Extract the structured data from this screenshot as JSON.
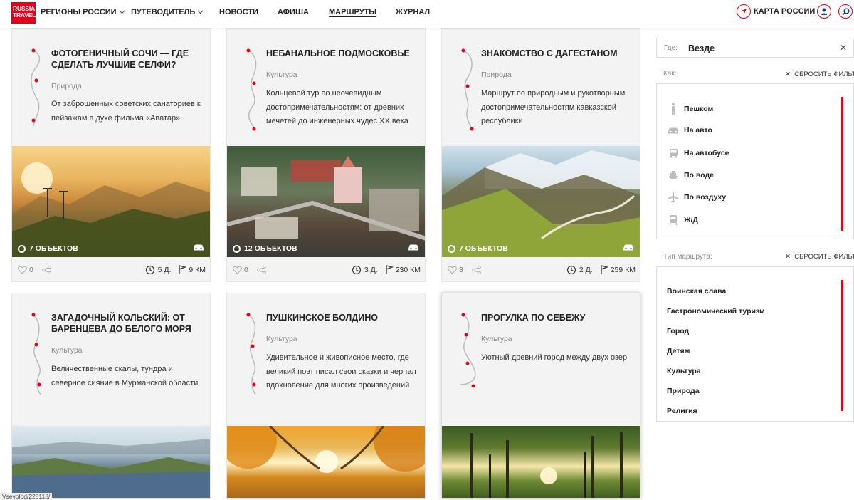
{
  "header": {
    "logo": {
      "line1": "RUSSIA",
      "line2": "TRAVEL"
    },
    "nav": [
      "РЕГИОНЫ РОССИИ",
      "ПУТЕВОДИТЕЛЬ",
      "НОВОСТИ",
      "АФИША",
      "МАРШРУТЫ",
      "ЖУРНАЛ"
    ],
    "map_label": "КАРТА РОССИИ"
  },
  "cards": [
    {
      "title": "ФОТОГЕНИЧНЫЙ СОЧИ — ГДЕ СДЕЛАТЬ ЛУЧШИЕ СЕЛФИ?",
      "category": "Природа",
      "desc": "От заброшенных советских санаториев к пейзажам в духе фильма «Аватар»",
      "objects": "7 ОБЪЕКТОВ",
      "likes": "0",
      "duration": "5 Д.",
      "distance": "9 КМ"
    },
    {
      "title": "НЕБАНАЛЬНОЕ ПОДМОСКОВЬЕ",
      "category": "Культура",
      "desc": "Кольцевой тур по неочевидным достопримечательностям: от древних мечетей до инженерных чудес XX века",
      "objects": "12 ОБЪЕКТОВ",
      "likes": "0",
      "duration": "3 Д.",
      "distance": "230 КМ"
    },
    {
      "title": "ЗНАКОМСТВО С ДАГЕСТАНОМ",
      "category": "Природа",
      "desc": "Маршрут по природным и рукотворным достопримечательностям кавказской республики",
      "objects": "7 ОБЪЕКТОВ",
      "likes": "3",
      "duration": "2 Д.",
      "distance": "259 КМ"
    },
    {
      "title": "ЗАГАДОЧНЫЙ КОЛЬСКИЙ: ОТ БАРЕНЦЕВА ДО БЕЛОГО МОРЯ",
      "category": "Культура",
      "desc": "Величественные скалы, тундра и северное сияние в Мурманской области"
    },
    {
      "title": "ПУШКИНСКОЕ БОЛДИНО",
      "category": "Культура",
      "desc": "Удивительное и живописное место, где великий поэт писал свои сказки и черпал вдохновение для многих произведений"
    },
    {
      "title": "ПРОГУЛКА ПО СЕБЕЖУ",
      "category": "Культура",
      "desc": "Уютный древний город между двух озер"
    }
  ],
  "sidebar": {
    "where_label": "Где:",
    "where_value": "Везде",
    "how_label": "Как:",
    "reset_label": "СБРОСИТЬ ФИЛЬТРЫ",
    "how_items": [
      "Пешком",
      "На авто",
      "На автобусе",
      "По воде",
      "По воздуху",
      "Ж/Д"
    ],
    "type_label": "Тип маршрута:",
    "type_items": [
      "Воинская слава",
      "Гастрономический туризм",
      "Город",
      "Детям",
      "Культура",
      "Природа",
      "Религия"
    ]
  },
  "status_text": "Vsevolod/228118/",
  "accent_color": "#e3001b"
}
